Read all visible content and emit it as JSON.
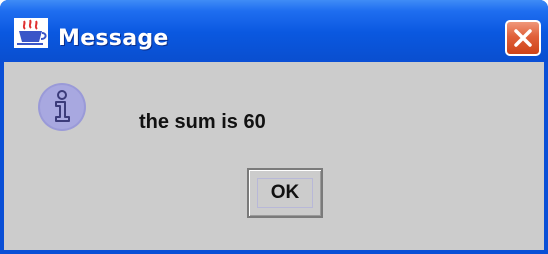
{
  "window": {
    "title": "Message",
    "title_bar_color": "#0a58e0",
    "background_color": "#cccccc"
  },
  "icons": {
    "app": "java-cup-icon",
    "close": "close-icon",
    "message": "information-icon"
  },
  "message": {
    "text": "the sum is 60"
  },
  "buttons": {
    "ok_label": "OK"
  }
}
